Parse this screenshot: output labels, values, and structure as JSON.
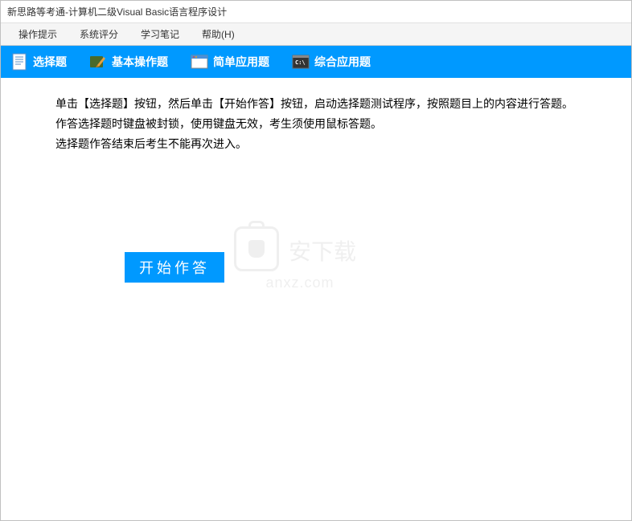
{
  "window": {
    "title": "新思路等考通-计算机二级Visual Basic语言程序设计"
  },
  "menu": {
    "items": [
      "操作提示",
      "系统评分",
      "学习笔记",
      "帮助(H)"
    ]
  },
  "toolbar": {
    "items": [
      "选择题",
      "基本操作题",
      "简单应用题",
      "综合应用题"
    ]
  },
  "content": {
    "line1": "单击【选择题】按钮，然后单击【开始作答】按钮，启动选择题测试程序，按照题目上的内容进行答题。",
    "line2": "作答选择题时键盘被封锁，使用键盘无效，考生须使用鼠标答题。",
    "line3": "选择题作答结束后考生不能再次进入。"
  },
  "button": {
    "start": "开始作答"
  },
  "watermark": {
    "text": "安下载",
    "url": "anxz.com"
  }
}
